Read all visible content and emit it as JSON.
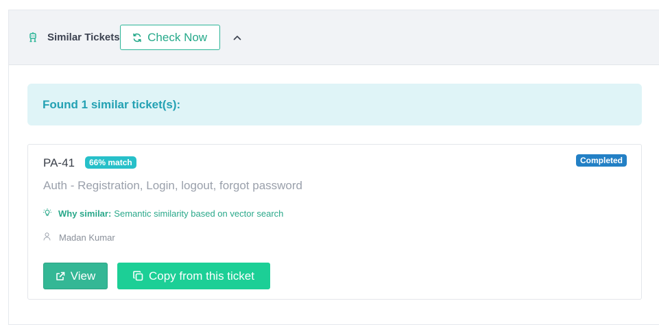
{
  "header": {
    "icon": "robot-icon",
    "title": "Similar Tickets",
    "check_button_label": "Check Now",
    "check_button_icon": "refresh-icon",
    "collapse_icon": "chevron-up-icon"
  },
  "alert": {
    "text": "Found 1 similar ticket(s):"
  },
  "tickets": [
    {
      "id": "PA-41",
      "match": "66% match",
      "status": "Completed",
      "title": "Auth - Registration, Login, logout, forgot password",
      "why_label": "Why similar:",
      "why_text": "Semantic similarity based on vector search",
      "assignee": "Madan Kumar",
      "view_label": "View",
      "copy_label": "Copy from this ticket"
    }
  ],
  "colors": {
    "accent": "#2bb597",
    "alert_bg": "#dff4f7",
    "alert_text": "#23a1b3",
    "match_badge": "#27c0c9",
    "status_badge": "#2380c5",
    "copy_button": "#1ccf96",
    "view_button": "#34b795"
  }
}
